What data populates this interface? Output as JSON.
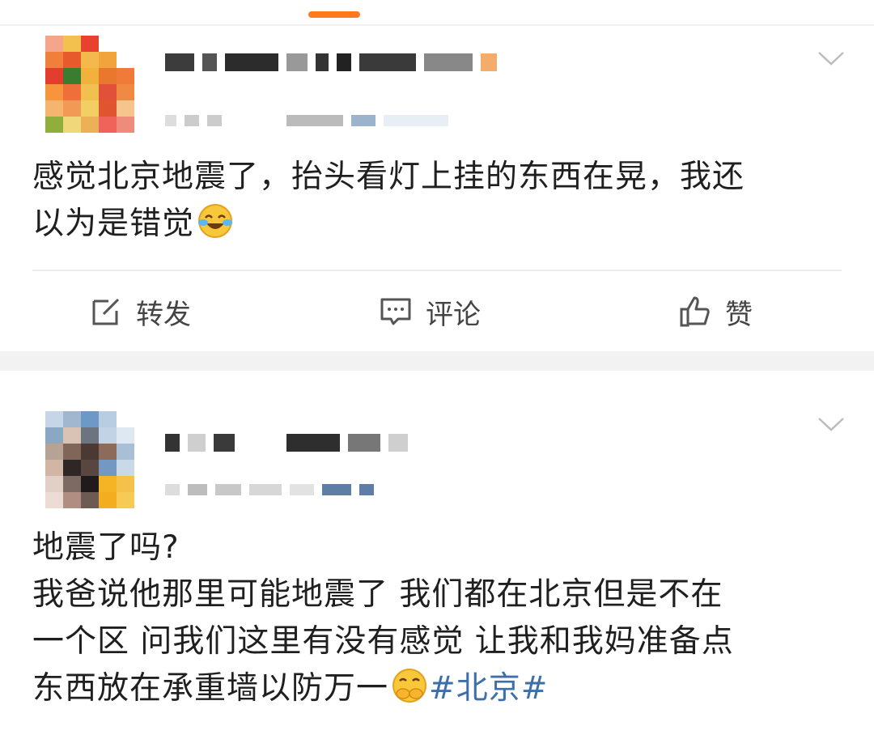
{
  "feed": {
    "posts": [
      {
        "text_line1": "感觉北京地震了，抬头看灯上挂的东西在晃，我还",
        "text_line2": "以为是错觉",
        "emoji": "laughing-crying-emoji",
        "actions": {
          "repost": "转发",
          "comment": "评论",
          "like": "赞"
        }
      },
      {
        "text_line1": "地震了吗?",
        "text_line2": "我爸说他那里可能地震了 我们都在北京但是不在",
        "text_line3": "一个区 问我们这里有没有感觉 让我和我妈准备点",
        "text_line4": "东西放在承重墙以防万一",
        "emoji": "covering-mouth-emoji",
        "hashtag": "#北京#"
      }
    ]
  },
  "colors": {
    "accent": "#ff7a1f",
    "hashtag": "#3e6fa8"
  }
}
